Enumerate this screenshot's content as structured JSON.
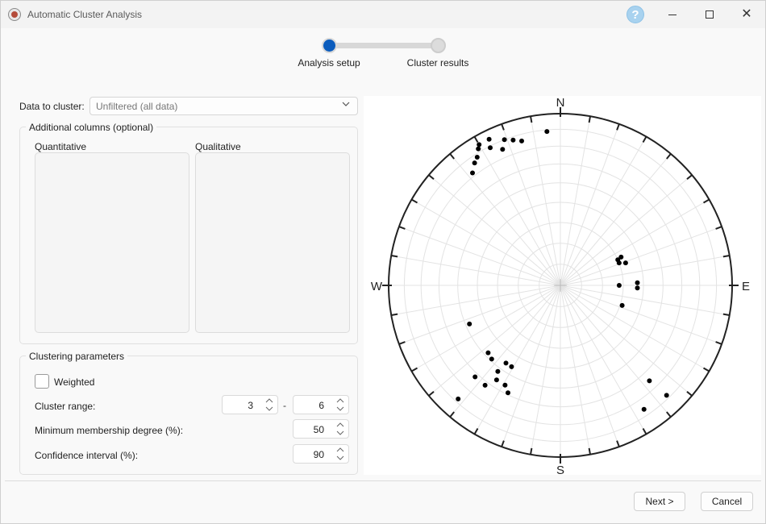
{
  "window": {
    "title": "Automatic Cluster Analysis",
    "help_label": "?"
  },
  "stepper": {
    "steps": [
      {
        "label": "Analysis setup",
        "state": "active"
      },
      {
        "label": "Cluster results",
        "state": "inactive"
      }
    ],
    "active_color": "#0b5cbd"
  },
  "setup": {
    "data_label": "Data to cluster:",
    "data_value": "Unfiltered (all data)",
    "additional": {
      "title": "Additional columns (optional)",
      "quantitative_label": "Quantitative",
      "qualitative_label": "Qualitative"
    },
    "clustering": {
      "title": "Clustering parameters",
      "weighted_label": "Weighted",
      "weighted_checked": false,
      "cluster_range_label": "Cluster range:",
      "range_min": "3",
      "range_sep": "-",
      "range_max": "6",
      "membership_label": "Minimum membership degree (%):",
      "membership_value": "50",
      "confidence_label": "Confidence interval (%):",
      "confidence_value": "90"
    }
  },
  "stereonet": {
    "labels": {
      "north": "N",
      "south": "S",
      "east": "E",
      "west": "W"
    },
    "poles": [
      {
        "trend": 322,
        "plunge": 18
      },
      {
        "trend": 325,
        "plunge": 14
      },
      {
        "trend": 327,
        "plunge": 12
      },
      {
        "trend": 329,
        "plunge": 8
      },
      {
        "trend": 330,
        "plunge": 6
      },
      {
        "trend": 333,
        "plunge": 11
      },
      {
        "trend": 334,
        "plunge": 6
      },
      {
        "trend": 337,
        "plunge": 15
      },
      {
        "trend": 339,
        "plunge": 10
      },
      {
        "trend": 342,
        "plunge": 12
      },
      {
        "trend": 345,
        "plunge": 14
      },
      {
        "trend": 355,
        "plunge": 11
      },
      {
        "trend": 65,
        "plunge": 58
      },
      {
        "trend": 66,
        "plunge": 60
      },
      {
        "trend": 69,
        "plunge": 60
      },
      {
        "trend": 71,
        "plunge": 57
      },
      {
        "trend": 88,
        "plunge": 53
      },
      {
        "trend": 90,
        "plunge": 62
      },
      {
        "trend": 92,
        "plunge": 53
      },
      {
        "trend": 108,
        "plunge": 59
      },
      {
        "trend": 136,
        "plunge": 12
      },
      {
        "trend": 137,
        "plunge": 25
      },
      {
        "trend": 146,
        "plunge": 14
      },
      {
        "trend": 206,
        "plunge": 31
      },
      {
        "trend": 209,
        "plunge": 34
      },
      {
        "trend": 211,
        "plunge": 44
      },
      {
        "trend": 214,
        "plunge": 34
      },
      {
        "trend": 215,
        "plunge": 44
      },
      {
        "trend": 216,
        "plunge": 38
      },
      {
        "trend": 217,
        "plunge": 28
      },
      {
        "trend": 223,
        "plunge": 28
      },
      {
        "trend": 223,
        "plunge": 41
      },
      {
        "trend": 227,
        "plunge": 42
      },
      {
        "trend": 222,
        "plunge": 12
      },
      {
        "trend": 247,
        "plunge": 42
      }
    ]
  },
  "footer": {
    "next_label": "Next >",
    "cancel_label": "Cancel"
  }
}
